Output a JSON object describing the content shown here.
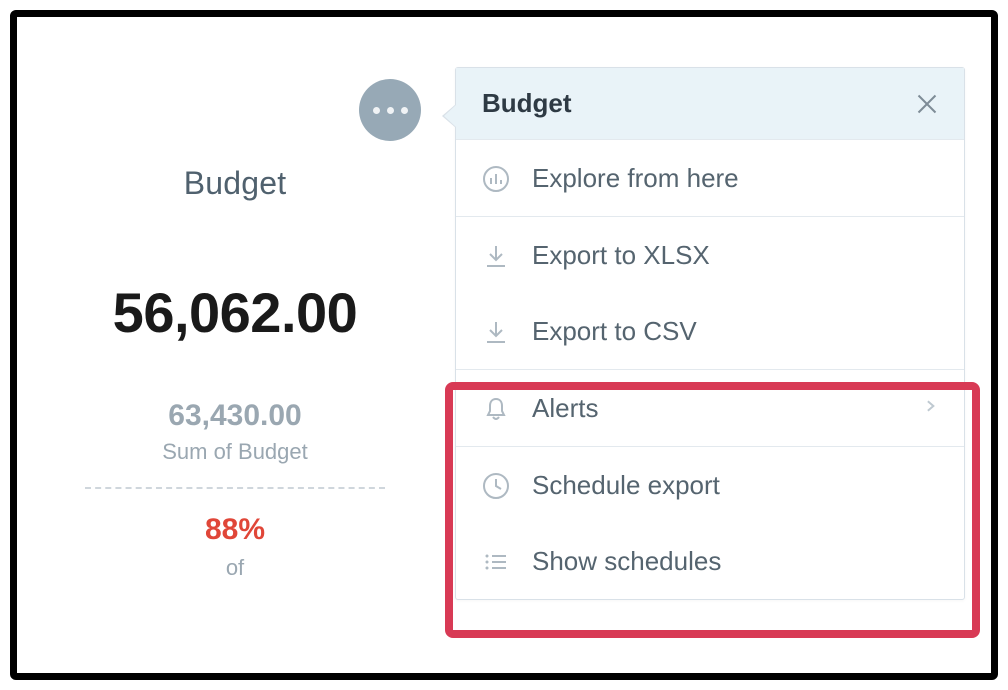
{
  "kpi": {
    "title": "Budget",
    "value": "56,062.00",
    "sum_value": "63,430.00",
    "sum_label": "Sum of Budget",
    "percent": "88%",
    "of_label": "of"
  },
  "menu": {
    "title": "Budget",
    "items": {
      "explore": "Explore from here",
      "export_xlsx": "Export to XLSX",
      "export_csv": "Export to CSV",
      "alerts": "Alerts",
      "schedule_export": "Schedule export",
      "show_schedules": "Show schedules"
    }
  }
}
